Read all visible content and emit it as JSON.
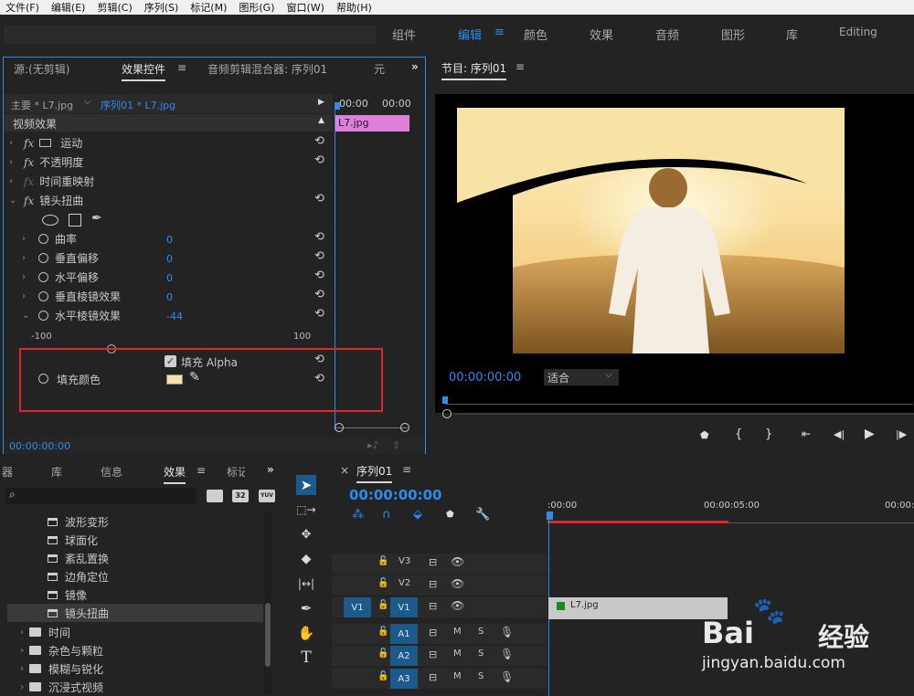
{
  "menu": [
    "文件(F)",
    "编辑(E)",
    "剪辑(C)",
    "序列(S)",
    "标记(M)",
    "图形(G)",
    "窗口(W)",
    "帮助(H)"
  ],
  "workspaces": {
    "tabs": [
      "组件",
      "编辑",
      "颜色",
      "效果",
      "音频",
      "图形",
      "库",
      "Editing"
    ],
    "active": "编辑",
    "menu_icon": "≡"
  },
  "effect_controls": {
    "tabs": [
      "源:(无剪辑)",
      "效果控件",
      "音频剪辑混合器: 序列01",
      "元"
    ],
    "menu_icon": "≡",
    "master_clip": "主要 * L7.jpg",
    "sequence_clip": "序列01 * L7.jpg",
    "ruler_start": "00:00",
    "ruler_end": "00:00",
    "clip_label": "L7.jpg",
    "section": "视频效果",
    "effects": [
      {
        "name": "运动",
        "fx": "fx"
      },
      {
        "name": "不透明度",
        "fx": "fx"
      },
      {
        "name": "时间重映射",
        "fx": "fx"
      },
      {
        "name": "镜头扭曲",
        "fx": "fx"
      }
    ],
    "params": [
      {
        "name": "曲率",
        "value": "0"
      },
      {
        "name": "垂直偏移",
        "value": "0"
      },
      {
        "name": "水平偏移",
        "value": "0"
      },
      {
        "name": "垂直棱镜效果",
        "value": "0"
      },
      {
        "name": "水平棱镜效果",
        "value": "-44"
      }
    ],
    "slider_min": "-100",
    "slider_max": "100",
    "fill_alpha_label": "填充 Alpha",
    "fill_color_label": "填充颜色",
    "fill_color": "#f7e3a6",
    "timecode": "00:00:00:00",
    "highlight_color": "#e0262e"
  },
  "program": {
    "title": "节目: 序列01",
    "menu_icon": "≡",
    "timecode": "00:00:00:00",
    "fit": "适合"
  },
  "effects_panel": {
    "tabs": [
      "器",
      "库",
      "信息",
      "效果",
      "标记"
    ],
    "active": "效果",
    "search_placeholder": "",
    "badges": [
      "32",
      "YUV"
    ],
    "items": [
      {
        "label": "波形变形",
        "type": "preset"
      },
      {
        "label": "球面化",
        "type": "preset"
      },
      {
        "label": "紊乱置换",
        "type": "preset"
      },
      {
        "label": "边角定位",
        "type": "preset"
      },
      {
        "label": "镜像",
        "type": "preset"
      },
      {
        "label": "镜头扭曲",
        "type": "preset",
        "selected": true
      },
      {
        "label": "时间",
        "type": "folder"
      },
      {
        "label": "杂色与颗粒",
        "type": "folder"
      },
      {
        "label": "模糊与锐化",
        "type": "folder"
      },
      {
        "label": "沉浸式视频",
        "type": "folder"
      }
    ]
  },
  "timeline": {
    "title": "序列01",
    "menu_icon": "≡",
    "timecode": "00:00:00:00",
    "ruler": [
      ":00:00",
      "00:00:05:00",
      "00:00:"
    ],
    "video_tracks": [
      "V3",
      "V2",
      "V1"
    ],
    "audio_tracks": [
      "A1",
      "A2",
      "A3"
    ],
    "source_patch": "V1",
    "clip_label": "L7.jpg",
    "track_buttons": [
      "M",
      "S"
    ]
  },
  "watermark": {
    "logo_text": "Bai",
    "logo_suffix": "经验",
    "url": "jingyan.baidu.com"
  }
}
